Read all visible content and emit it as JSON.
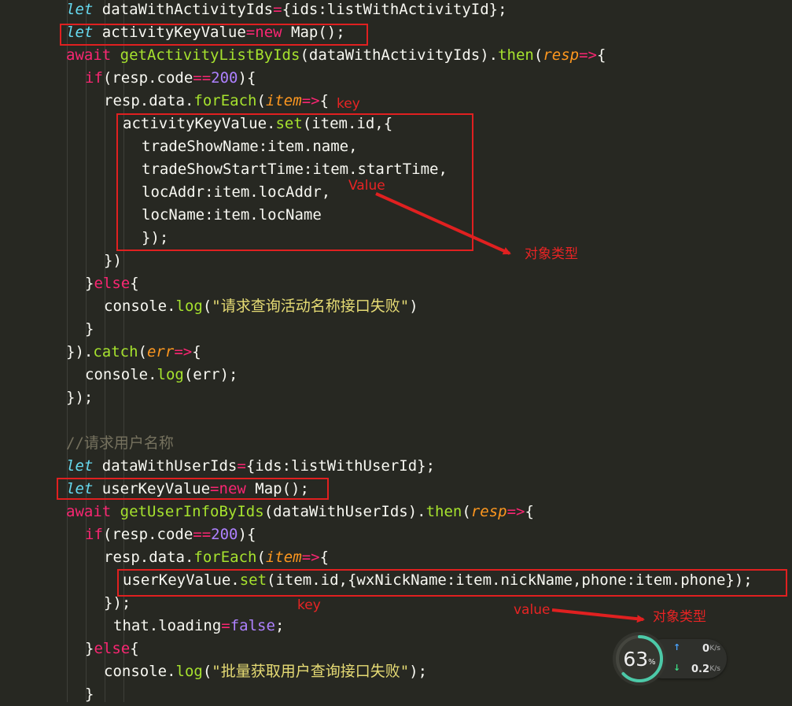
{
  "code_lines": [
    [
      [
        "t-kw",
        "let"
      ],
      [
        "t-txt",
        " dataWithActivityIds"
      ],
      [
        "t-red",
        "="
      ],
      [
        "t-txt",
        "{ids:listWithActivityId};"
      ]
    ],
    [
      [
        "t-kw",
        "let"
      ],
      [
        "t-txt",
        " activityKeyValue"
      ],
      [
        "t-red",
        "="
      ],
      [
        "t-red",
        "new"
      ],
      [
        "t-txt",
        " Map();"
      ]
    ],
    [
      [
        "t-red",
        "await"
      ],
      [
        "t-txt",
        " "
      ],
      [
        "t-fn",
        "getActivityListByIds"
      ],
      [
        "t-txt",
        "(dataWithActivityIds)."
      ],
      [
        "t-fn",
        "then"
      ],
      [
        "t-txt",
        "("
      ],
      [
        "t-par",
        "resp"
      ],
      [
        "t-red",
        "=>"
      ],
      [
        "t-txt",
        "{"
      ]
    ],
    [
      [
        "t-red",
        "if"
      ],
      [
        "t-txt",
        "(resp.code"
      ],
      [
        "t-red",
        "=="
      ],
      [
        "t-num",
        "200"
      ],
      [
        "t-txt",
        "){"
      ]
    ],
    [
      [
        "t-txt",
        "resp.data."
      ],
      [
        "t-fn",
        "forEach"
      ],
      [
        "t-txt",
        "("
      ],
      [
        "t-par",
        "item"
      ],
      [
        "t-red",
        "=>"
      ],
      [
        "t-txt",
        "{"
      ]
    ],
    [
      [
        "t-txt",
        "activityKeyValue."
      ],
      [
        "t-fn",
        "set"
      ],
      [
        "t-txt",
        "(item.id,{"
      ]
    ],
    [
      [
        "t-txt",
        "tradeShowName:item.name,"
      ]
    ],
    [
      [
        "t-txt",
        "tradeShowStartTime:item.startTime,"
      ]
    ],
    [
      [
        "t-txt",
        "locAddr:item.locAddr,"
      ]
    ],
    [
      [
        "t-txt",
        "locName:item.locName"
      ]
    ],
    [
      [
        "t-txt",
        "});"
      ]
    ],
    [
      [
        "t-txt",
        "})"
      ]
    ],
    [
      [
        "t-txt",
        "}"
      ],
      [
        "t-red",
        "else"
      ],
      [
        "t-txt",
        "{"
      ]
    ],
    [
      [
        "t-txt",
        "console."
      ],
      [
        "t-fn",
        "log"
      ],
      [
        "t-txt",
        "("
      ],
      [
        "t-str",
        "\"请求查询活动名称接口失败\""
      ],
      [
        "t-txt",
        ")"
      ]
    ],
    [
      [
        "t-txt",
        "}"
      ]
    ],
    [
      [
        "t-txt",
        "})."
      ],
      [
        "t-fn",
        "catch"
      ],
      [
        "t-txt",
        "("
      ],
      [
        "t-par",
        "err"
      ],
      [
        "t-red",
        "=>"
      ],
      [
        "t-txt",
        "{"
      ]
    ],
    [
      [
        "t-txt",
        "console."
      ],
      [
        "t-fn",
        "log"
      ],
      [
        "t-txt",
        "(err);"
      ]
    ],
    [
      [
        "t-txt",
        "});"
      ]
    ],
    [],
    [
      [
        "t-cm",
        "//请求用户名称"
      ]
    ],
    [
      [
        "t-kw",
        "let"
      ],
      [
        "t-txt",
        " dataWithUserIds"
      ],
      [
        "t-red",
        "="
      ],
      [
        "t-txt",
        "{ids:listWithUserId};"
      ]
    ],
    [
      [
        "t-kw",
        "let"
      ],
      [
        "t-txt",
        " userKeyValue"
      ],
      [
        "t-red",
        "="
      ],
      [
        "t-red",
        "new"
      ],
      [
        "t-txt",
        " Map();"
      ]
    ],
    [
      [
        "t-red",
        "await"
      ],
      [
        "t-txt",
        " "
      ],
      [
        "t-fn",
        "getUserInfoByIds"
      ],
      [
        "t-txt",
        "(dataWithUserIds)."
      ],
      [
        "t-fn",
        "then"
      ],
      [
        "t-txt",
        "("
      ],
      [
        "t-par",
        "resp"
      ],
      [
        "t-red",
        "=>"
      ],
      [
        "t-txt",
        "{"
      ]
    ],
    [
      [
        "t-red",
        "if"
      ],
      [
        "t-txt",
        "(resp.code"
      ],
      [
        "t-red",
        "=="
      ],
      [
        "t-num",
        "200"
      ],
      [
        "t-txt",
        "){"
      ]
    ],
    [
      [
        "t-txt",
        "resp.data."
      ],
      [
        "t-fn",
        "forEach"
      ],
      [
        "t-txt",
        "("
      ],
      [
        "t-par",
        "item"
      ],
      [
        "t-red",
        "=>"
      ],
      [
        "t-txt",
        "{"
      ]
    ],
    [
      [
        "t-txt",
        "userKeyValue."
      ],
      [
        "t-fn",
        "set"
      ],
      [
        "t-txt",
        "(item.id,{wxNickName:item.nickName,phone:item.phone});"
      ]
    ],
    [
      [
        "t-txt",
        "});"
      ]
    ],
    [
      [
        "t-txt",
        "that.loading"
      ],
      [
        "t-red",
        "="
      ],
      [
        "t-num",
        "false"
      ],
      [
        "t-txt",
        ";"
      ]
    ],
    [
      [
        "t-txt",
        "}"
      ],
      [
        "t-red",
        "else"
      ],
      [
        "t-txt",
        "{"
      ]
    ],
    [
      [
        "t-txt",
        "console."
      ],
      [
        "t-fn",
        "log"
      ],
      [
        "t-txt",
        "("
      ],
      [
        "t-str",
        "\"批量获取用户查询接口失败\""
      ],
      [
        "t-txt",
        ");"
      ]
    ],
    [
      [
        "t-txt",
        "}"
      ]
    ]
  ],
  "annotations": {
    "key_top": "key",
    "value_top": "Value",
    "type_top": "对象类型",
    "key_bottom": "key",
    "value_bottom": "value",
    "type_bottom": "对象类型"
  },
  "network_widget": {
    "percent": "63",
    "percent_unit": "%",
    "usage_fraction": 0.63,
    "upload_value": "0",
    "download_value": "0.2",
    "unit": "K/s",
    "ring_color": "#4cc9a8"
  },
  "colors": {
    "background": "#272822",
    "annotation_red": "#e02020"
  }
}
